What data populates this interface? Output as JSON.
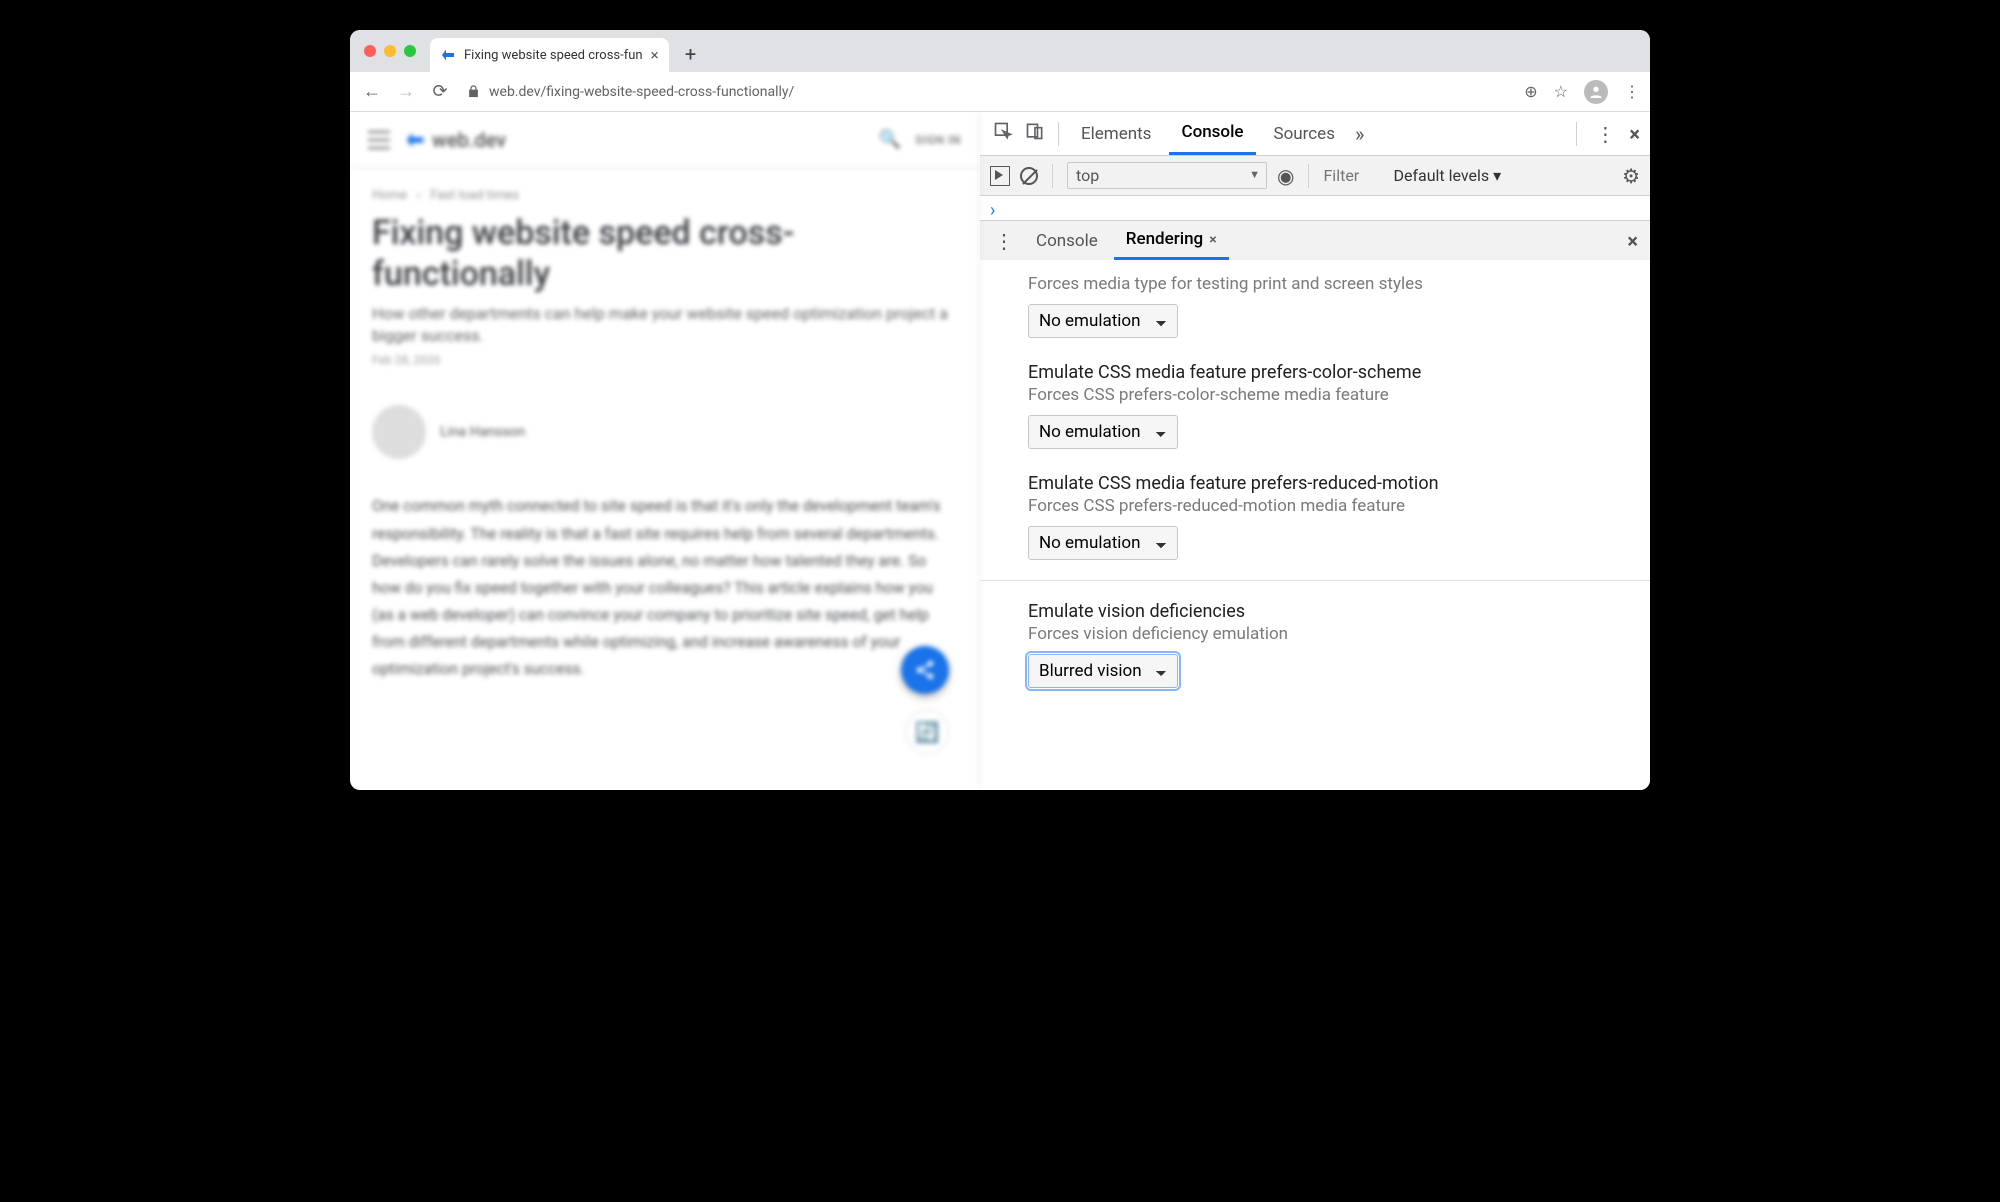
{
  "browser": {
    "tab_title": "Fixing website speed cross-fun",
    "url": "web.dev/fixing-website-speed-cross-functionally/"
  },
  "page": {
    "brand": "web.dev",
    "signin": "SIGN IN",
    "breadcrumb_home": "Home",
    "breadcrumb_section": "Fast load times",
    "title": "Fixing website speed cross-functionally",
    "subtitle": "How other departments can help make your website speed optimization project a bigger success.",
    "date": "Feb 28, 2020",
    "author": "Lina Hansson",
    "body": "One common myth connected to site speed is that it's only the development team's responsibility. The reality is that a fast site requires help from several departments. Developers can rarely solve the issues alone, no matter how talented they are. So how do you fix speed together with your colleagues? This article explains how you (as a web developer) can convince your company to prioritize site speed, get help from different departments while optimizing, and increase awareness of your optimization project's success."
  },
  "devtools": {
    "tabs": {
      "elements": "Elements",
      "console": "Console",
      "sources": "Sources"
    },
    "console_toolbar": {
      "context": "top",
      "filter_placeholder": "Filter",
      "levels": "Default levels ▾"
    },
    "drawer": {
      "console": "Console",
      "rendering": "Rendering"
    },
    "rendering": {
      "media_type": {
        "desc": "Forces media type for testing print and screen styles",
        "value": "No emulation"
      },
      "color_scheme": {
        "title": "Emulate CSS media feature prefers-color-scheme",
        "desc": "Forces CSS prefers-color-scheme media feature",
        "value": "No emulation"
      },
      "reduced_motion": {
        "title": "Emulate CSS media feature prefers-reduced-motion",
        "desc": "Forces CSS prefers-reduced-motion media feature",
        "value": "No emulation"
      },
      "vision": {
        "title": "Emulate vision deficiencies",
        "desc": "Forces vision deficiency emulation",
        "value": "Blurred vision"
      }
    }
  }
}
